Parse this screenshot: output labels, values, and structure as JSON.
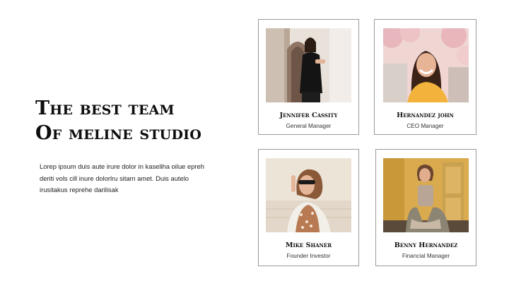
{
  "headline": {
    "line1": "The best team",
    "line2": "Of meline studio"
  },
  "description": "Lorep  ipsum duis aute irure dolor in kaseliha oilue epreh deriti vols cill inure dolorlru sitam amet. Duis autelo irusitakus reprehe darilisak",
  "team": [
    {
      "name": "Jennifer Cassity",
      "role": "General Manager"
    },
    {
      "name": "Hernandez john",
      "role": "CEO Manager"
    },
    {
      "name": "Mike Shaner",
      "role": "Founder Investor"
    },
    {
      "name": "Benny Hernandez",
      "role": "Financial Manager"
    }
  ],
  "colors": {
    "background": "#ffffff",
    "text": "#111111",
    "card_border": "#9a9a9a"
  }
}
